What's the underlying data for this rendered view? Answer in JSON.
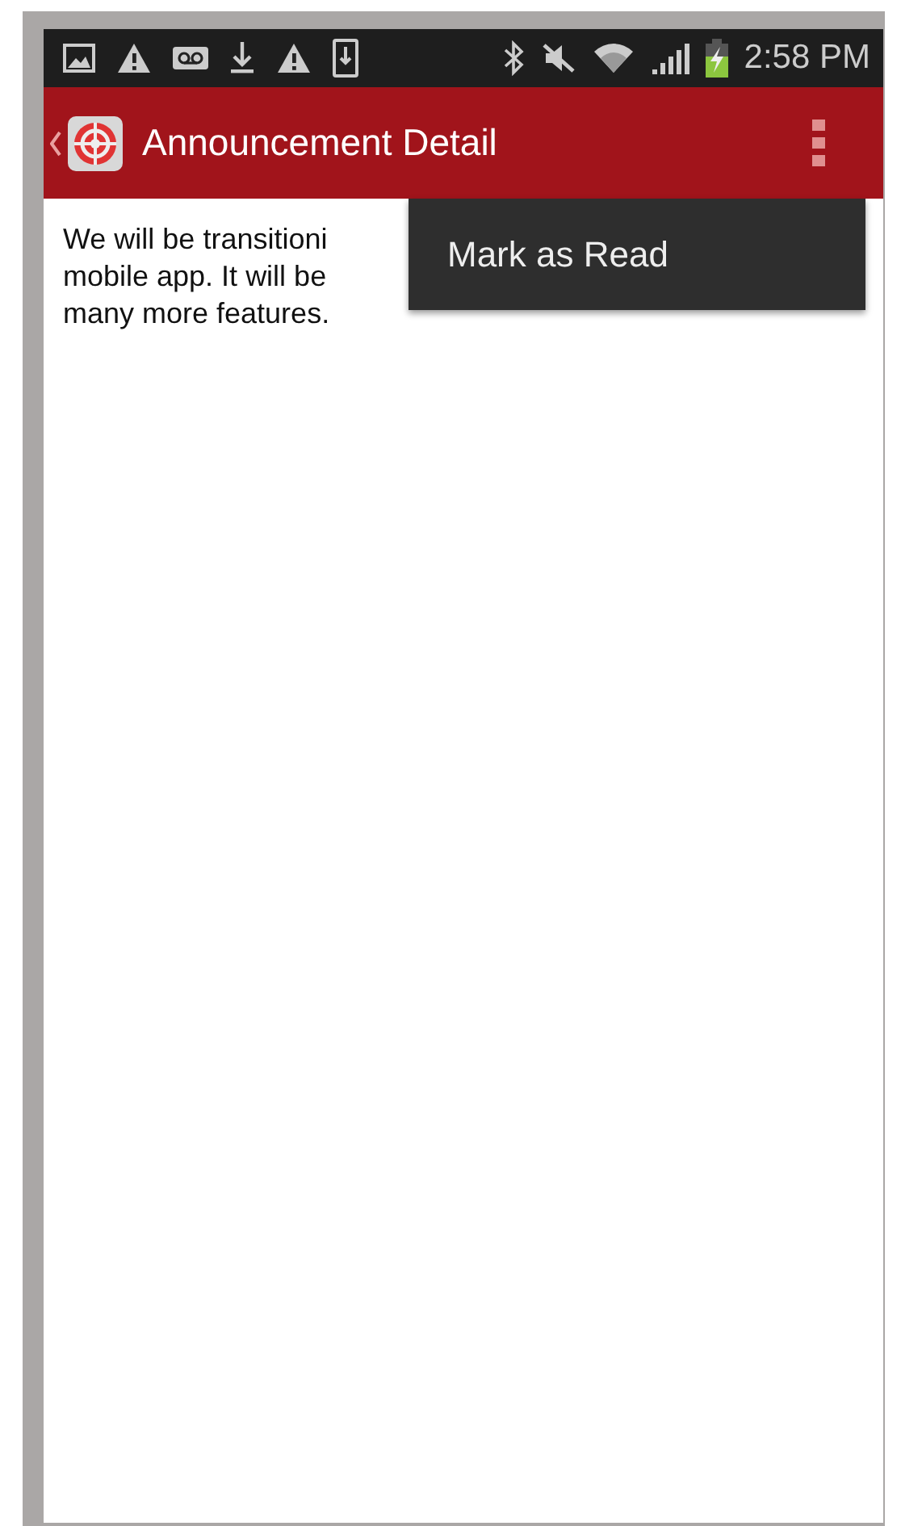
{
  "status_bar": {
    "time": "2:58 PM"
  },
  "app_bar": {
    "title": "Announcement Detail"
  },
  "body": {
    "lines": [
      "We will be transitioni",
      "mobile app. It will be",
      "many more features."
    ]
  },
  "overflow_menu": {
    "items": [
      {
        "label": "Mark as Read"
      }
    ]
  }
}
